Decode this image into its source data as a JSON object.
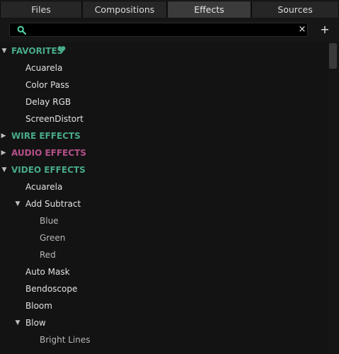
{
  "tabs": [
    {
      "label": "Files",
      "active": false
    },
    {
      "label": "Compositions",
      "active": false
    },
    {
      "label": "Effects",
      "active": true
    },
    {
      "label": "Sources",
      "active": false
    }
  ],
  "search": {
    "value": "",
    "placeholder": "",
    "clear_glyph": "×",
    "icon": "search-icon"
  },
  "toolbar": {
    "add_glyph": "+"
  },
  "colors": {
    "green_category": "#48aa8a",
    "pink_category": "#b5508a",
    "active_tab": "#3b3b3b"
  },
  "tree": {
    "favorites": {
      "label": "FAVORITES",
      "expanded": true,
      "icon": "heart-icon",
      "items": [
        "Acuarela",
        "Color Pass",
        "Delay RGB",
        "ScreenDistort"
      ]
    },
    "wire_effects": {
      "label": "WIRE EFFECTS",
      "expanded": false
    },
    "audio_effects": {
      "label": "AUDIO EFFECTS",
      "expanded": false
    },
    "video_effects": {
      "label": "VIDEO EFFECTS",
      "expanded": true,
      "items": [
        {
          "label": "Acuarela"
        },
        {
          "label": "Add Subtract",
          "expanded": true,
          "children": [
            "Blue",
            "Green",
            "Red"
          ]
        },
        {
          "label": "Auto Mask"
        },
        {
          "label": "Bendoscope"
        },
        {
          "label": "Bloom"
        },
        {
          "label": "Blow",
          "expanded": true,
          "children": [
            "Bright Lines"
          ]
        }
      ]
    }
  }
}
